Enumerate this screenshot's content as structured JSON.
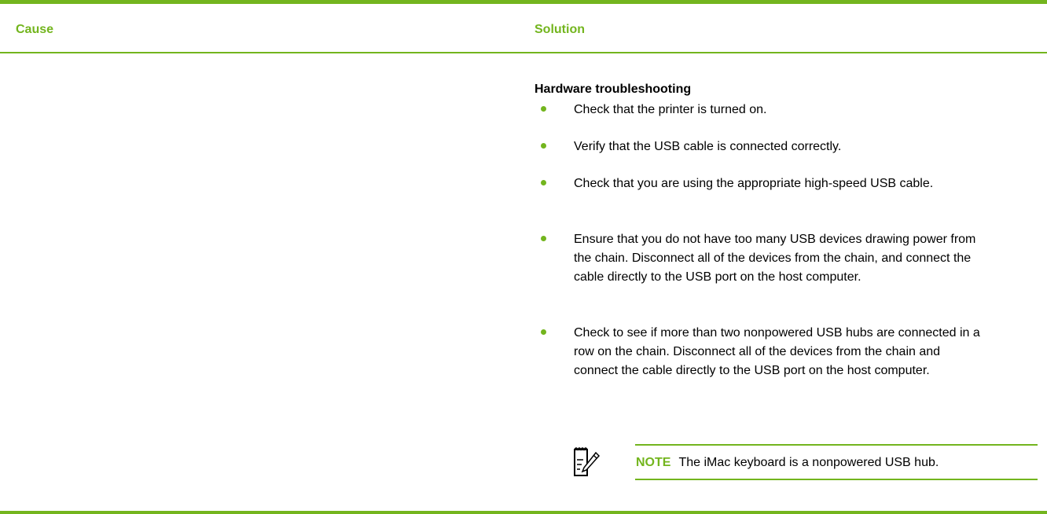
{
  "table": {
    "header": {
      "cause": "Cause",
      "solution": "Solution"
    },
    "section_title": "Hardware troubleshooting",
    "bullets": [
      {
        "text": "Check that the printer is turned on."
      },
      {
        "text": "Verify that the USB cable is connected correctly."
      },
      {
        "text": "Check that you are using the appropriate high-speed USB cable."
      },
      {
        "text": "Ensure that you do not have too many USB devices drawing power from the chain. Disconnect all of the devices from the chain, and connect the cable directly to the USB port on the host computer."
      },
      {
        "text": "Check to see if more than two nonpowered USB hubs are connected in a row on the chain. Disconnect all of the devices from the chain and connect the cable directly to the USB port on the host computer."
      }
    ],
    "note": {
      "label": "NOTE",
      "text": "The iMac keyboard is a nonpowered USB hub.",
      "icon": "note-pencil-icon"
    }
  },
  "colors": {
    "accent": "#73b51e",
    "text": "#000000"
  }
}
